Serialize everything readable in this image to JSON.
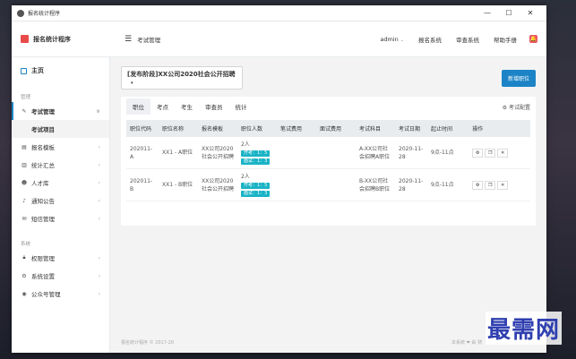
{
  "window": {
    "title": "报名统计程序",
    "controls": [
      "—",
      "☐",
      "✕"
    ]
  },
  "header": {
    "brand": "报名统计程序",
    "breadcrumb": "考试管理",
    "user": "admin",
    "links": [
      "报名系统",
      "审查系统",
      "帮助手册"
    ]
  },
  "sidebar": {
    "home": "主页",
    "section_manage": "管理",
    "items": [
      {
        "label": "考试管理",
        "icon": "edit-icon"
      },
      {
        "label": "报名模板",
        "icon": "template-icon"
      },
      {
        "label": "统计汇总",
        "icon": "chart-icon"
      },
      {
        "label": "人才库",
        "icon": "users-icon"
      },
      {
        "label": "通知公告",
        "icon": "bell-icon"
      },
      {
        "label": "短信管理",
        "icon": "mail-icon"
      }
    ],
    "sub_item": "考试项目",
    "section_system": "系统",
    "system_items": [
      {
        "label": "权限管理",
        "icon": "lock-icon"
      },
      {
        "label": "系统设置",
        "icon": "gear-icon"
      },
      {
        "label": "公众号管理",
        "icon": "wechat-icon"
      }
    ]
  },
  "main": {
    "exam_select": "[发布阶段]XX公司2020社会公开招聘",
    "add_button": "新增职位",
    "tabs": [
      "职位",
      "考点",
      "考生",
      "审查员",
      "统计"
    ],
    "config_link": "考试配置",
    "table": {
      "headers": [
        "职位代码",
        "职位名称",
        "报名模板",
        "职位人数",
        "笔试费用",
        "面试费用",
        "考试科目",
        "考试日期",
        "起止时间",
        "操作"
      ],
      "rows": [
        {
          "code": "202011-A",
          "name": "XX1 - A职位",
          "template": "XX公司2020社会公开招聘",
          "count": "2人",
          "tag1": "开考：1：5",
          "tag2": "面试：1：3",
          "written_fee": "",
          "interview_fee": "",
          "subject": "A-XX公司社会招聘A职位",
          "date": "2020-11-28",
          "time": "9点-11点"
        },
        {
          "code": "202011-B",
          "name": "XX1 - B职位",
          "template": "XX公司2020社会公开招聘",
          "count": "2人",
          "tag1": "开考：1：5",
          "tag2": "面试：1：3",
          "written_fee": "",
          "interview_fee": "",
          "subject": "B-XX公司社会招聘B职位",
          "date": "2020-11-28",
          "time": "9点-11点"
        }
      ]
    }
  },
  "footer": {
    "left": "报名统计程序 © 2017-20",
    "right": "本系统 ❤ 由 骑"
  },
  "watermark": "最需网"
}
